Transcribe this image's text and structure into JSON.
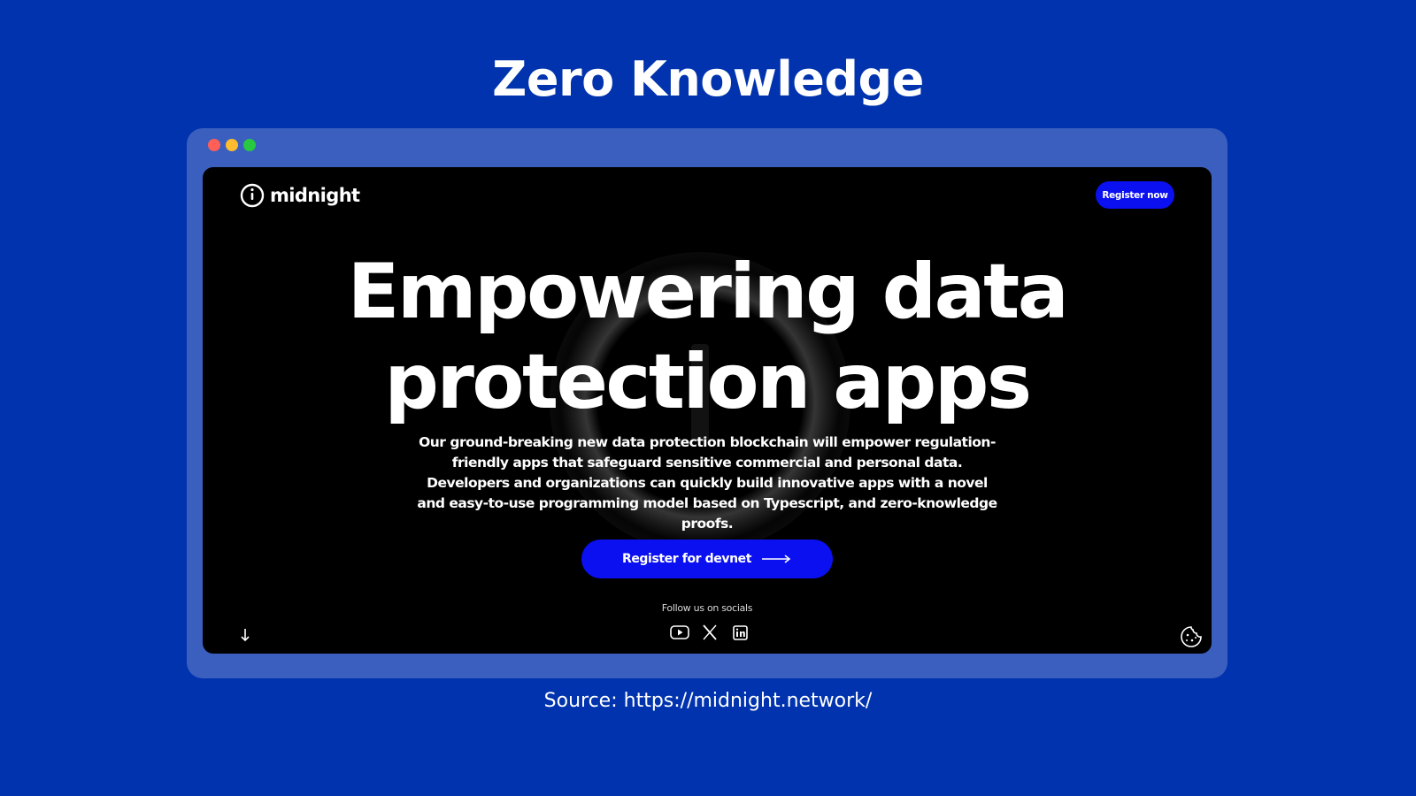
{
  "slide": {
    "title": "Zero Knowledge",
    "source": "Source: https://midnight.network/"
  },
  "window_controls": {
    "close_color": "#FF5F57",
    "minimize_color": "#FEBC2E",
    "maximize_color": "#28C840"
  },
  "site": {
    "brand": "midnight",
    "nav_button": "Register now",
    "hero_line1": "Empowering data",
    "hero_line2": "protection apps",
    "hero_body": "Our ground-breaking new data protection blockchain will empower regulation-friendly apps that safeguard sensitive commercial and personal data. Developers and organizations can quickly build innovative apps with a novel and easy-to-use programming model based on Typescript, and zero-knowledge proofs.",
    "cta_label": "Register for devnet",
    "socials_label": "Follow us on socials",
    "social_icons": [
      "youtube-icon",
      "x-icon",
      "linkedin-icon"
    ],
    "accent_color": "#0A10F0"
  },
  "colors": {
    "slide_background": "#0033AD",
    "frame": "#3A5FBF",
    "viewport_background": "#000000"
  }
}
